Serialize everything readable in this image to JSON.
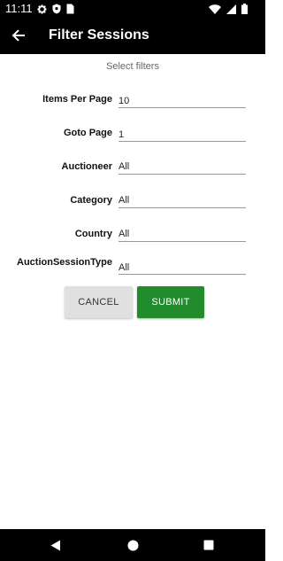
{
  "status_bar": {
    "time": "11:11",
    "left_icons": [
      "gear-icon",
      "shield-icon",
      "sim-card-icon"
    ],
    "right_icons": [
      "wifi-icon",
      "signal-icon",
      "battery-icon"
    ]
  },
  "app_bar": {
    "title": "Filter Sessions",
    "back_icon": "arrow-left-icon"
  },
  "subtitle": "Select filters",
  "form": {
    "items_per_page": {
      "label": "Items Per Page",
      "value": "10"
    },
    "goto_page": {
      "label": "Goto Page",
      "value": "1"
    },
    "auctioneer": {
      "label": "Auctioneer",
      "value": "All"
    },
    "category": {
      "label": "Category",
      "value": "All"
    },
    "country": {
      "label": "Country",
      "value": "All"
    },
    "auction_session_type": {
      "label": "AuctionSessionType",
      "value": "All"
    }
  },
  "buttons": {
    "cancel": "CANCEL",
    "submit": "SUBMIT"
  },
  "colors": {
    "bar_background": "#000000",
    "submit_green": "#218c2b",
    "cancel_grey": "#e0e0e0"
  }
}
